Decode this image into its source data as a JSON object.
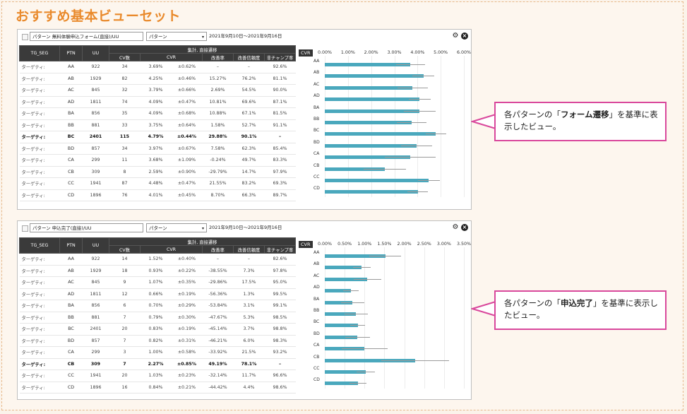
{
  "page_title": "おすすめ基本ビューセット",
  "colors": {
    "title": "#e98a2c",
    "bar": "#4aa8bd",
    "callout_border": "#d9489c",
    "header_bg": "#3a3a3a"
  },
  "views": [
    {
      "selector_label": "パターン 無料体験申込フォーム(直接)/UU",
      "dimension": "パターン",
      "date_range": "2021年9月10日～2021年9月16日",
      "columns": {
        "seg": "TG_SEG",
        "ptn": "PTN",
        "uu": "UU",
        "group": "集計, 直接遷移",
        "cv": "CV数",
        "cvr": "CVR",
        "improve": "改善率",
        "confidence": "改善信頼度",
        "nonchamp": "非チャンプ率"
      },
      "rows": [
        {
          "seg": "ターゲティ:",
          "ptn": "AA",
          "uu": "922",
          "cv": "34",
          "cvr": "3.69%",
          "pm": "±0.62%",
          "improve": "–",
          "conf": "–",
          "nonchamp": "92.6%"
        },
        {
          "seg": "ターゲティ:",
          "ptn": "AB",
          "uu": "1929",
          "cv": "82",
          "cvr": "4.25%",
          "pm": "±0.46%",
          "improve": "15.27%",
          "conf": "76.2%",
          "nonchamp": "81.1%"
        },
        {
          "seg": "ターゲティ:",
          "ptn": "AC",
          "uu": "845",
          "cv": "32",
          "cvr": "3.79%",
          "pm": "±0.66%",
          "improve": "2.69%",
          "conf": "54.5%",
          "nonchamp": "90.0%"
        },
        {
          "seg": "ターゲティ:",
          "ptn": "AD",
          "uu": "1811",
          "cv": "74",
          "cvr": "4.09%",
          "pm": "±0.47%",
          "improve": "10.81%",
          "conf": "69.6%",
          "nonchamp": "87.1%"
        },
        {
          "seg": "ターゲティ:",
          "ptn": "BA",
          "uu": "856",
          "cv": "35",
          "cvr": "4.09%",
          "pm": "±0.68%",
          "improve": "10.88%",
          "conf": "67.1%",
          "nonchamp": "81.5%"
        },
        {
          "seg": "ターゲティ:",
          "ptn": "BB",
          "uu": "881",
          "cv": "33",
          "cvr": "3.75%",
          "pm": "±0.64%",
          "improve": "1.58%",
          "conf": "52.7%",
          "nonchamp": "91.1%"
        },
        {
          "seg": "ターゲティ:",
          "ptn": "BC",
          "uu": "2401",
          "cv": "115",
          "cvr": "4.79%",
          "pm": "±0.44%",
          "improve": "29.88%",
          "conf": "90.1%",
          "nonchamp": "–",
          "bold": true
        },
        {
          "seg": "ターゲティ:",
          "ptn": "BD",
          "uu": "857",
          "cv": "34",
          "cvr": "3.97%",
          "pm": "±0.67%",
          "improve": "7.58%",
          "conf": "62.3%",
          "nonchamp": "85.4%"
        },
        {
          "seg": "ターゲティ:",
          "ptn": "CA",
          "uu": "299",
          "cv": "11",
          "cvr": "3.68%",
          "pm": "±1.09%",
          "improve": "-0.24%",
          "conf": "49.7%",
          "nonchamp": "83.3%"
        },
        {
          "seg": "ターゲティ:",
          "ptn": "CB",
          "uu": "309",
          "cv": "8",
          "cvr": "2.59%",
          "pm": "±0.90%",
          "improve": "-29.79%",
          "conf": "14.7%",
          "nonchamp": "97.9%"
        },
        {
          "seg": "ターゲティ:",
          "ptn": "CC",
          "uu": "1941",
          "cv": "87",
          "cvr": "4.48%",
          "pm": "±0.47%",
          "improve": "21.55%",
          "conf": "83.2%",
          "nonchamp": "69.3%"
        },
        {
          "seg": "ターゲティ:",
          "ptn": "CD",
          "uu": "1896",
          "cv": "76",
          "cvr": "4.01%",
          "pm": "±0.45%",
          "improve": "8.70%",
          "conf": "66.3%",
          "nonchamp": "89.7%"
        }
      ],
      "chart_data": {
        "type": "bar",
        "label": "CVR",
        "xlim": [
          0,
          6
        ],
        "ticks": [
          "0.00%",
          "1.00%",
          "2.00%",
          "3.00%",
          "4.00%",
          "5.00%",
          "6.00%"
        ],
        "categories": [
          "AA",
          "AB",
          "AC",
          "AD",
          "BA",
          "BB",
          "BC",
          "BD",
          "CA",
          "CB",
          "CC",
          "CD"
        ],
        "values": [
          3.69,
          4.25,
          3.79,
          4.09,
          4.09,
          3.75,
          4.79,
          3.97,
          3.68,
          2.59,
          4.48,
          4.01
        ],
        "errors": [
          0.62,
          0.46,
          0.66,
          0.47,
          0.68,
          0.64,
          0.44,
          0.67,
          1.09,
          0.9,
          0.47,
          0.45
        ]
      },
      "callout": {
        "pre": "各パターンの「",
        "bold": "フォーム遷移",
        "post": "」を基準に表示したビュー。"
      }
    },
    {
      "selector_label": "パターン 申込完了(直接)/UU",
      "dimension": "パターン",
      "date_range": "2021年9月10日～2021年9月16日",
      "columns": {
        "seg": "TG_SEG",
        "ptn": "PTN",
        "uu": "UU",
        "group": "集計, 直接遷移",
        "cv": "CV数",
        "cvr": "CVR",
        "improve": "改善率",
        "confidence": "改善信頼度",
        "nonchamp": "非チャンプ率"
      },
      "rows": [
        {
          "seg": "ターゲティ:",
          "ptn": "AA",
          "uu": "922",
          "cv": "14",
          "cvr": "1.52%",
          "pm": "±0.40%",
          "improve": "–",
          "conf": "–",
          "nonchamp": "82.6%"
        },
        {
          "seg": "ターゲティ:",
          "ptn": "AB",
          "uu": "1929",
          "cv": "18",
          "cvr": "0.93%",
          "pm": "±0.22%",
          "improve": "-38.55%",
          "conf": "7.3%",
          "nonchamp": "97.8%"
        },
        {
          "seg": "ターゲティ:",
          "ptn": "AC",
          "uu": "845",
          "cv": "9",
          "cvr": "1.07%",
          "pm": "±0.35%",
          "improve": "-29.86%",
          "conf": "17.5%",
          "nonchamp": "95.0%"
        },
        {
          "seg": "ターゲティ:",
          "ptn": "AD",
          "uu": "1811",
          "cv": "12",
          "cvr": "0.66%",
          "pm": "±0.19%",
          "improve": "-56.36%",
          "conf": "1.3%",
          "nonchamp": "99.5%"
        },
        {
          "seg": "ターゲティ:",
          "ptn": "BA",
          "uu": "856",
          "cv": "6",
          "cvr": "0.70%",
          "pm": "±0.29%",
          "improve": "-53.84%",
          "conf": "3.1%",
          "nonchamp": "99.1%"
        },
        {
          "seg": "ターゲティ:",
          "ptn": "BB",
          "uu": "881",
          "cv": "7",
          "cvr": "0.79%",
          "pm": "±0.30%",
          "improve": "-47.67%",
          "conf": "5.3%",
          "nonchamp": "98.5%"
        },
        {
          "seg": "ターゲティ:",
          "ptn": "BC",
          "uu": "2401",
          "cv": "20",
          "cvr": "0.83%",
          "pm": "±0.19%",
          "improve": "-45.14%",
          "conf": "3.7%",
          "nonchamp": "98.8%"
        },
        {
          "seg": "ターゲティ:",
          "ptn": "BD",
          "uu": "857",
          "cv": "7",
          "cvr": "0.82%",
          "pm": "±0.31%",
          "improve": "-46.21%",
          "conf": "6.0%",
          "nonchamp": "98.3%"
        },
        {
          "seg": "ターゲティ:",
          "ptn": "CA",
          "uu": "299",
          "cv": "3",
          "cvr": "1.00%",
          "pm": "±0.58%",
          "improve": "-33.92%",
          "conf": "21.5%",
          "nonchamp": "93.2%"
        },
        {
          "seg": "ターゲティ:",
          "ptn": "CB",
          "uu": "309",
          "cv": "7",
          "cvr": "2.27%",
          "pm": "±0.85%",
          "improve": "49.19%",
          "conf": "78.1%",
          "nonchamp": "–",
          "bold": true
        },
        {
          "seg": "ターゲティ:",
          "ptn": "CC",
          "uu": "1941",
          "cv": "20",
          "cvr": "1.03%",
          "pm": "±0.23%",
          "improve": "-32.14%",
          "conf": "11.7%",
          "nonchamp": "96.6%"
        },
        {
          "seg": "ターゲティ:",
          "ptn": "CD",
          "uu": "1896",
          "cv": "16",
          "cvr": "0.84%",
          "pm": "±0.21%",
          "improve": "-44.42%",
          "conf": "4.4%",
          "nonchamp": "98.6%"
        }
      ],
      "chart_data": {
        "type": "bar",
        "label": "CVR",
        "xlim": [
          0,
          3.5
        ],
        "ticks": [
          "0.00%",
          "0.50%",
          "1.00%",
          "1.50%",
          "2.00%",
          "2.50%",
          "3.00%",
          "3.50%"
        ],
        "categories": [
          "AA",
          "AB",
          "AC",
          "AD",
          "BA",
          "BB",
          "BC",
          "BD",
          "CA",
          "CB",
          "CC",
          "CD"
        ],
        "values": [
          1.52,
          0.93,
          1.07,
          0.66,
          0.7,
          0.79,
          0.83,
          0.82,
          1.0,
          2.27,
          1.03,
          0.84
        ],
        "errors": [
          0.4,
          0.22,
          0.35,
          0.19,
          0.29,
          0.3,
          0.19,
          0.31,
          0.58,
          0.85,
          0.23,
          0.21
        ]
      },
      "callout": {
        "pre": "各パターンの「",
        "bold": "申込完了",
        "post": "」を基準に表示したビュー。"
      }
    }
  ]
}
